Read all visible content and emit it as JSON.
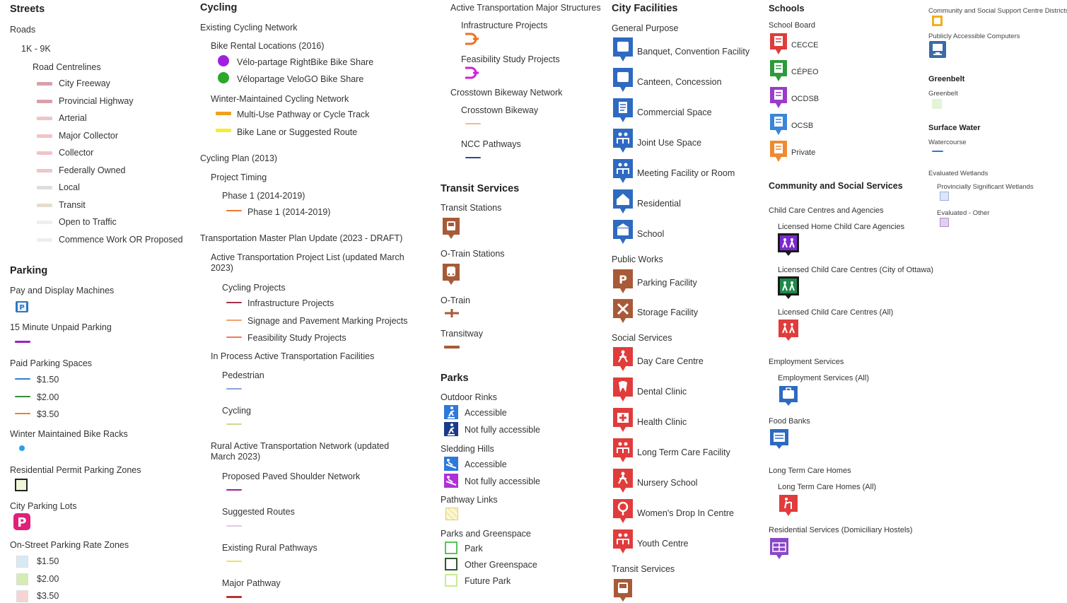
{
  "streets": {
    "title": "Streets",
    "roads": "Roads",
    "range": "1K - 9K",
    "centrelines": "Road Centrelines",
    "items": [
      {
        "label": "City Freeway",
        "color": "#d9a0aa"
      },
      {
        "label": "Provincial Highway",
        "color": "#d9a0aa"
      },
      {
        "label": "Arterial",
        "color": "#f0c4c8"
      },
      {
        "label": "Major Collector",
        "color": "#f0c4c8"
      },
      {
        "label": "Collector",
        "color": "#f0c4c8"
      },
      {
        "label": "Federally Owned",
        "color": "#f0c4c8"
      },
      {
        "label": "Local",
        "color": "#dddddd"
      },
      {
        "label": "Transit",
        "color": "#e3ddd0"
      },
      {
        "label": "Open to Traffic",
        "color": "#eeeeee"
      },
      {
        "label": "Commence Work OR Proposed",
        "color": "#eeeeee"
      }
    ]
  },
  "parking": {
    "title": "Parking",
    "pay_display": "Pay and Display Machines",
    "unpaid15": "15 Minute Unpaid Parking",
    "paid_spaces": "Paid Parking Spaces",
    "paid_items": [
      {
        "label": "$1.50",
        "color": "#2f7fd0"
      },
      {
        "label": "$2.00",
        "color": "#3a8a3a"
      },
      {
        "label": "$3.50",
        "color": "#f08030"
      }
    ],
    "bike_racks": "Winter Maintained Bike Racks",
    "permit_zones": "Residential Permit Parking Zones",
    "city_lots": "City Parking Lots",
    "rate_zones": "On-Street Parking Rate Zones",
    "rate_items": [
      {
        "label": "$1.50",
        "color": "#d8e9f6"
      },
      {
        "label": "$2.00",
        "color": "#d5ecb4"
      },
      {
        "label": "$3.50",
        "color": "#f6d4d6"
      }
    ]
  },
  "cycling": {
    "title": "Cycling",
    "existing": "Existing Cycling Network",
    "bike_rental": "Bike Rental Locations (2016)",
    "rightbike": "Vélo-partage RightBike Bike Share",
    "velogo": "Vélopartage VeloGO Bike Share",
    "winter": "Winter-Maintained Cycling Network",
    "multi_use": "Multi-Use Pathway or Cycle Track",
    "bike_lane": "Bike Lane or Suggested Route",
    "plan2013": "Cycling Plan (2013)",
    "timing": "Project Timing",
    "phase1": "Phase 1 (2014-2019)",
    "phase1_item": "Phase 1 (2014-2019)",
    "tmp": "Transportation Master Plan Update (2023 - DRAFT)",
    "atpl": "Active Transportation Project List (updated March 2023)",
    "cycling_projects": "Cycling Projects",
    "cp_items": [
      {
        "label": "Infrastructure Projects",
        "color": "#a0334a"
      },
      {
        "label": "Signage and Pavement Marking Projects",
        "color": "#f0a070"
      },
      {
        "label": "Feasibility Study Projects",
        "color": "#f07858"
      }
    ],
    "in_process": "In Process Active Transportation Facilities",
    "pedestrian": "Pedestrian",
    "cycling_item": "Cycling",
    "rural": "Rural Active Transportation Network (updated March 2023)",
    "paved_shoulder": "Proposed Paved Shoulder Network",
    "suggested": "Suggested Routes",
    "existing_rural": "Existing Rural Pathways",
    "major_pathway": "Major Pathway"
  },
  "at_structures": {
    "title": "Active Transportation Major Structures",
    "infra": "Infrastructure Projects",
    "feas": "Feasibility Study Projects",
    "crosstown_net": "Crosstown Bikeway Network",
    "crosstown": "Crosstown Bikeway",
    "ncc": "NCC Pathways"
  },
  "transit": {
    "title": "Transit Services",
    "stations": "Transit Stations",
    "otrain_stations": "O-Train Stations",
    "otrain": "O-Train",
    "transitway": "Transitway"
  },
  "parks": {
    "title": "Parks",
    "outdoor_rinks": "Outdoor Rinks",
    "accessible": "Accessible",
    "not_accessible": "Not fully accessible",
    "sledding": "Sledding Hills",
    "sled_accessible": "Accessible",
    "sled_not_accessible": "Not fully accessible",
    "pathway_links": "Pathway Links",
    "greenspace": "Parks and Greenspace",
    "park": "Park",
    "other_green": "Other Greenspace",
    "future_park": "Future Park"
  },
  "city_facilities": {
    "title": "City Facilities",
    "general": "General Purpose",
    "general_items": [
      {
        "label": "Banquet, Convention Facility",
        "icon": "banquet-icon"
      },
      {
        "label": "Canteen, Concession",
        "icon": "canteen-icon"
      },
      {
        "label": "Commercial Space",
        "icon": "commercial-icon"
      },
      {
        "label": "Joint Use Space",
        "icon": "joint-use-icon"
      },
      {
        "label": "Meeting Facility or Room",
        "icon": "meeting-icon"
      },
      {
        "label": "Residential",
        "icon": "residential-icon"
      },
      {
        "label": "School",
        "icon": "school-icon"
      }
    ],
    "public_works": "Public Works",
    "pw_items": [
      {
        "label": "Parking Facility",
        "icon": "parking-facility-icon"
      },
      {
        "label": "Storage Facility",
        "icon": "storage-icon"
      }
    ],
    "social": "Social Services",
    "social_items": [
      {
        "label": "Day Care Centre",
        "icon": "daycare-icon"
      },
      {
        "label": "Dental Clinic",
        "icon": "dental-icon"
      },
      {
        "label": "Health Clinic",
        "icon": "health-icon"
      },
      {
        "label": "Long Term Care Facility",
        "icon": "ltc-icon"
      },
      {
        "label": "Nursery School",
        "icon": "nursery-icon"
      },
      {
        "label": "Women's Drop In Centre",
        "icon": "women-icon"
      },
      {
        "label": "Youth Centre",
        "icon": "youth-icon"
      }
    ],
    "transit_services": "Transit Services"
  },
  "schools": {
    "title": "Schools",
    "board": "School Board",
    "items": [
      {
        "label": "CECCE",
        "color": "#e03c3c"
      },
      {
        "label": "CÉPEO",
        "color": "#2e9a3a"
      },
      {
        "label": "OCDSB",
        "color": "#9a3cc8"
      },
      {
        "label": "OCSB",
        "color": "#3a86d8"
      },
      {
        "label": "Private",
        "color": "#f08a30"
      }
    ]
  },
  "community": {
    "title": "Community and Social Services",
    "child_care": "Child Care Centres and Agencies",
    "home_child": "Licensed Home Child Care Agencies",
    "ccc_ottawa": "Licensed Child Care Centres (City of Ottawa)",
    "ccc_all": "Licensed Child Care Centres (All)",
    "employment": "Employment Services",
    "employment_all": "Employment Services (All)",
    "food": "Food Banks",
    "ltc": "Long Term Care Homes",
    "ltc_all": "Long Term Care Homes (All)",
    "residential": "Residential Services (Domiciliary Hostels)"
  },
  "far_right": {
    "districts": "Community and Social Support Centre Districts",
    "computers": "Publicly Accessible Computers",
    "greenbelt_title": "Greenbelt",
    "greenbelt": "Greenbelt",
    "surface_water": "Surface Water",
    "watercourse": "Watercourse",
    "wetlands": "Evaluated Wetlands",
    "provincial": "Provincially Significant Wetlands",
    "other_wet": "Evaluated - Other"
  }
}
